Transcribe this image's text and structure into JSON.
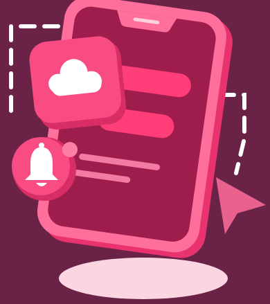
{
  "colors": {
    "background": "#6a2346",
    "phone_body": "#ff6f9c",
    "phone_edge": "#f0457f",
    "screen": "#9e1d4d",
    "accent": "#ff3d78",
    "card": "#f94c83",
    "soft_text_line": "#f37aa3",
    "icon_white": "#ffffff",
    "shadow_ellipse": "#fbd6e2",
    "cursor": "#e9628e",
    "dashed_outline": "#ffffff"
  },
  "icons": {
    "cloud": "cloud-icon",
    "bell": "bell-icon",
    "cursor": "pointer-cursor-icon"
  }
}
